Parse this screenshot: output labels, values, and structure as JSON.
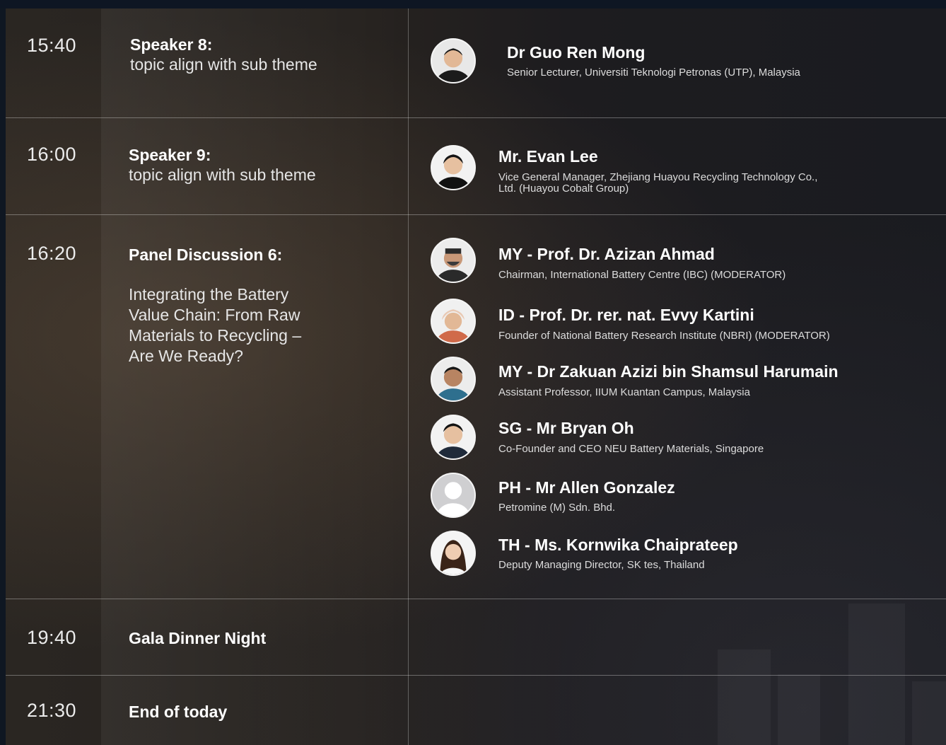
{
  "sessions": [
    {
      "time": "15:40",
      "title": "Speaker 8:",
      "subtitle": "topic align with sub theme",
      "speakers": [
        {
          "name": "Dr Guo Ren Mong",
          "role": "Senior Lecturer, Universiti Teknologi Petronas (UTP), Malaysia"
        }
      ]
    },
    {
      "time": "16:00",
      "title": "Speaker 9:",
      "subtitle": "topic align with sub theme",
      "speakers": [
        {
          "name": "Mr. Evan Lee",
          "role": "Vice General Manager, Zhejiang Huayou Recycling Technology Co., Ltd. (Huayou Cobalt Group)"
        }
      ]
    },
    {
      "time": "16:20",
      "title": "Panel Discussion 6:",
      "subtitle": "Integrating the Battery Value Chain: From Raw Materials to Recycling – Are We Ready?",
      "speakers": [
        {
          "name": "MY - Prof. Dr. Azizan Ahmad",
          "role": "Chairman, International Battery Centre (IBC) (MODERATOR)"
        },
        {
          "name": "ID - Prof. Dr. rer. nat. Evvy Kartini",
          "role": "Founder of National Battery Research Institute (NBRI) (MODERATOR)"
        },
        {
          "name": "MY - Dr Zakuan Azizi bin Shamsul Harumain",
          "role": "Assistant Professor, IIUM Kuantan Campus, Malaysia"
        },
        {
          "name": "SG - Mr Bryan Oh",
          "role": "Co-Founder and CEO NEU Battery Materials, Singapore"
        },
        {
          "name": "PH - Mr Allen Gonzalez",
          "role": "Petromine (M) Sdn. Bhd."
        },
        {
          "name": "TH - Ms. Kornwika Chaiprateep",
          "role": "Deputy Managing Director, SK tes, Thailand"
        }
      ]
    },
    {
      "time": "19:40",
      "title": "Gala Dinner Night"
    },
    {
      "time": "21:30",
      "title": "End of today"
    }
  ],
  "colors": {
    "background": "#1f1d1e",
    "divider": "#8a8a8a",
    "text": "#ffffff"
  }
}
